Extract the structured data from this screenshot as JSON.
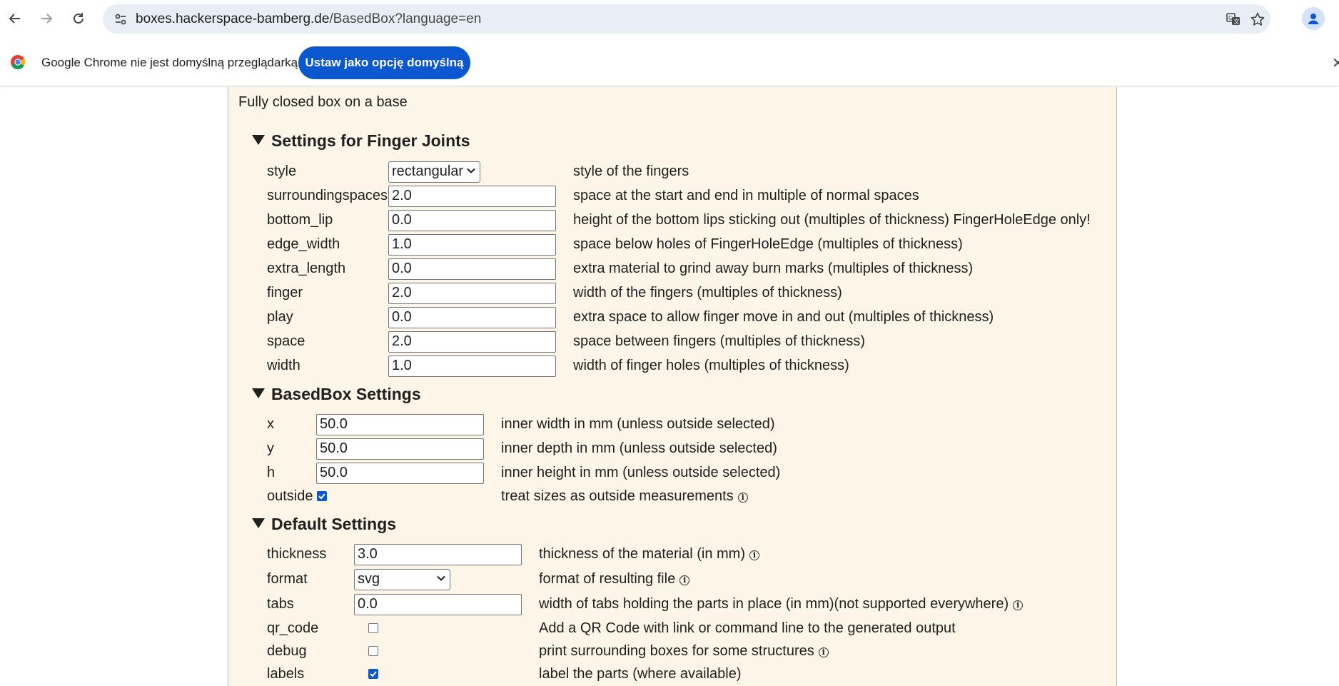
{
  "browser": {
    "url_host": "boxes.hackerspace-bamberg.de",
    "url_path": "/BasedBox?language=en"
  },
  "infobar": {
    "message": "Google Chrome nie jest domyślną przeglądarką",
    "default_button": "Ustaw jako opcję domyślną",
    "close": "✕"
  },
  "page": {
    "description": "Fully closed box on a base"
  },
  "finger_joints": {
    "title": "Settings for Finger Joints",
    "style": {
      "label": "style",
      "value": "rectangular",
      "help": "style of the fingers"
    },
    "surroundingspaces": {
      "label": "surroundingspaces",
      "value": "2.0",
      "help": "space at the start and end in multiple of normal spaces"
    },
    "bottom_lip": {
      "label": "bottom_lip",
      "value": "0.0",
      "help": "height of the bottom lips sticking out (multiples of thickness) FingerHoleEdge only!"
    },
    "edge_width": {
      "label": "edge_width",
      "value": "1.0",
      "help": "space below holes of FingerHoleEdge (multiples of thickness)"
    },
    "extra_length": {
      "label": "extra_length",
      "value": "0.0",
      "help": "extra material to grind away burn marks (multiples of thickness)"
    },
    "finger": {
      "label": "finger",
      "value": "2.0",
      "help": "width of the fingers (multiples of thickness)"
    },
    "play": {
      "label": "play",
      "value": "0.0",
      "help": "extra space to allow finger move in and out (multiples of thickness)"
    },
    "space": {
      "label": "space",
      "value": "2.0",
      "help": "space between fingers (multiples of thickness)"
    },
    "width": {
      "label": "width",
      "value": "1.0",
      "help": "width of finger holes (multiples of thickness)"
    }
  },
  "basedbox": {
    "title": "BasedBox Settings",
    "x": {
      "label": "x",
      "value": "50.0",
      "help": "inner width in mm (unless outside selected)"
    },
    "y": {
      "label": "y",
      "value": "50.0",
      "help": "inner depth in mm (unless outside selected)"
    },
    "h": {
      "label": "h",
      "value": "50.0",
      "help": "inner height in mm (unless outside selected)"
    },
    "outside": {
      "label": "outside",
      "checked": true,
      "help": "treat sizes as outside measurements"
    }
  },
  "defaults": {
    "title": "Default Settings",
    "thickness": {
      "label": "thickness",
      "value": "3.0",
      "help": "thickness of the material (in mm)"
    },
    "format": {
      "label": "format",
      "value": "svg",
      "help": "format of resulting file"
    },
    "tabs": {
      "label": "tabs",
      "value": "0.0",
      "help": "width of tabs holding the parts in place (in mm)(not supported everywhere)"
    },
    "qr_code": {
      "label": "qr_code",
      "checked": false,
      "help": "Add a QR Code with link or command line to the generated output"
    },
    "debug": {
      "label": "debug",
      "checked": false,
      "help": "print surrounding boxes for some structures"
    },
    "labels": {
      "label": "labels",
      "checked": true,
      "help": "label the parts (where available)"
    }
  },
  "info_glyph": "i"
}
